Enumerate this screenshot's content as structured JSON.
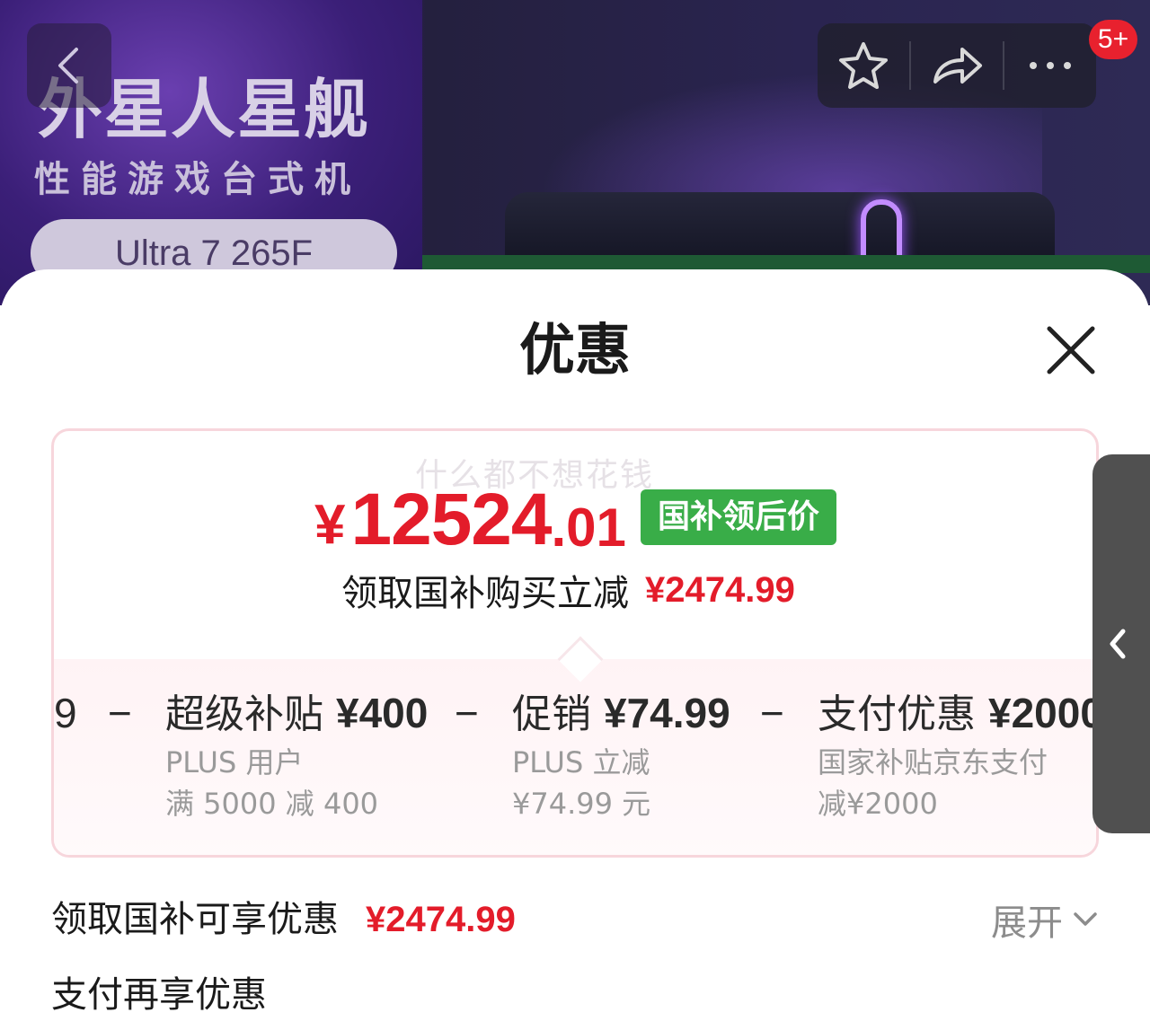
{
  "banner": {
    "title": "外星人星舰",
    "subtitle": "性能游戏台式机",
    "cpu_pill": "Ultra 7 265F",
    "message_badge": "5+"
  },
  "icons": {
    "back": "chevron-left-icon",
    "favorite": "star-icon",
    "share": "share-icon",
    "more": "more-dots-icon",
    "close": "close-icon",
    "expand": "chevron-down-icon",
    "side_tab": "chevron-left-icon"
  },
  "sheet": {
    "title": "优惠",
    "watermark": "什么都不想花钱",
    "final_price": {
      "currency": "¥",
      "integer": "12524",
      "decimal": ".01",
      "tag": "国补领后价"
    },
    "saving": {
      "label": "领取国补购买立减",
      "amount": "¥2474.99"
    },
    "breakdown": {
      "leading_fragment": "9",
      "items": [
        {
          "title": "超级补贴",
          "amount": "¥400",
          "note_line1": "PLUS 用户",
          "note_line2": "满 5000 减 400"
        },
        {
          "title": "促销",
          "amount": "¥74.99",
          "note_line1": "PLUS 立减",
          "note_line2": "¥74.99 元"
        },
        {
          "title": "支付优惠",
          "amount": "¥2000",
          "note_line1": "国家补贴京东支付",
          "note_line2": "减¥2000"
        }
      ],
      "minus": "−"
    },
    "subsidy_row": {
      "label": "领取国补可享优惠",
      "amount": "¥2474.99",
      "toggle": "展开"
    },
    "payment_row": {
      "label": "支付再享优惠"
    }
  },
  "colors": {
    "price_red": "#e31c2a",
    "tag_green": "#39ad48",
    "card_border": "#f7d6dc"
  }
}
